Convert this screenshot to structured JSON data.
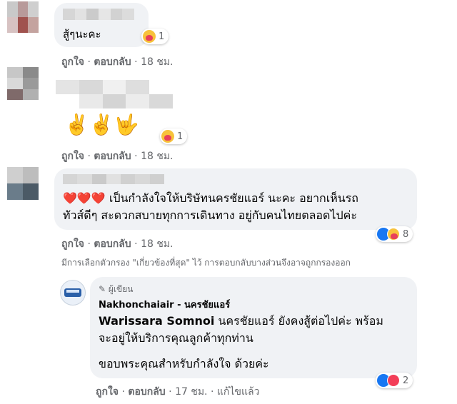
{
  "comments": [
    {
      "text": "สู้ๆนะคะ",
      "reaction_count": "1",
      "actions": {
        "like": "ถูกใจ",
        "reply": "ตอบกลับ",
        "time": "18 ชม."
      }
    },
    {
      "text": "✌️✌️🤟",
      "reaction_count": "1",
      "actions": {
        "like": "ถูกใจ",
        "reply": "ตอบกลับ",
        "time": "18 ชม."
      }
    },
    {
      "text_line1": "❤️❤️❤️ เป็นกำลังใจให้บริษัทนครชัยแอร์ นะคะ อยากเห็นรถ",
      "text_line2": "ทัวส์ดีๆ สะดวกสบายทุกการเดินทาง อยู่กับคนไทยตลอดไปค่ะ",
      "reaction_count": "8",
      "actions": {
        "like": "ถูกใจ",
        "reply": "ตอบกลับ",
        "time": "18 ชม."
      }
    }
  ],
  "filter_notice": "มีการเลือกตัวกรอง \"เกี่ยวข้องที่สุด\" ไว้ การตอบกลับบางส่วนจึงอาจถูกกรองออก",
  "reply": {
    "author_badge": "ผู้เขียน",
    "page_name": "Nakhonchaiair - นครชัยแอร์",
    "tagged_name": "Warissara Somnoi",
    "text_line1": " นครชัยแอร์ ยังคงสู้ต่อไปค่ะ พร้อม",
    "text_line2": "จะอยู่ให้บริการคุณลูกค้าทุกท่าน",
    "text_line3": "ขอบพระคุณสำหรับกำลังใจ ด้วยค่ะ",
    "reaction_count": "2",
    "actions": {
      "like": "ถูกใจ",
      "reply": "ตอบกลับ",
      "time": "17 ชม.",
      "edited": "แก้ไขแล้ว"
    }
  },
  "colors": {
    "bubble": "#f0f2f5",
    "secondary_text": "#65676b",
    "like_blue": "#1877f2",
    "love_red": "#f33e58"
  }
}
